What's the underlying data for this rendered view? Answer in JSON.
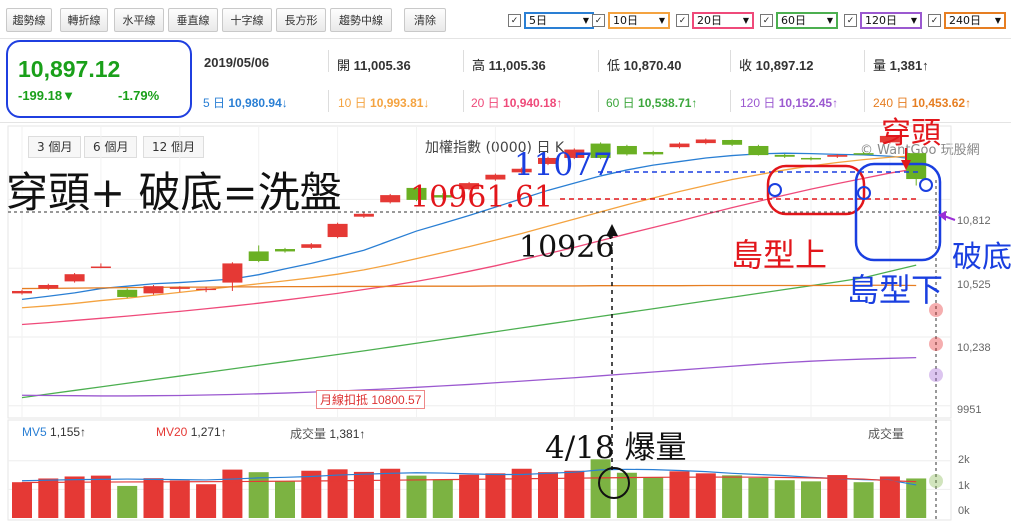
{
  "toolbar": {
    "buttons": [
      "趨勢線",
      "轉折線",
      "水平線",
      "垂直線",
      "十字線",
      "長方形",
      "趨勢中線",
      "清除"
    ],
    "ma_selectors": [
      {
        "label": "5日",
        "color": "#2a7fd4",
        "checked": true
      },
      {
        "label": "10日",
        "color": "#f4a340",
        "checked": true
      },
      {
        "label": "20日",
        "color": "#ef4a7a",
        "checked": true
      },
      {
        "label": "60日",
        "color": "#4caf50",
        "checked": true
      },
      {
        "label": "120日",
        "color": "#9b59d0",
        "checked": true
      },
      {
        "label": "240日",
        "color": "#e67e22",
        "checked": true
      }
    ]
  },
  "quote": {
    "price": "10,897.12",
    "change": "-199.18▼",
    "change_pct": "-1.79%",
    "date": "2019/05/06",
    "open_label": "開",
    "open": "11,005.36",
    "high_label": "高",
    "high": "11,005.36",
    "low_label": "低",
    "low": "10,870.40",
    "close_label": "收",
    "close": "10,897.12",
    "vol_label": "量",
    "vol": "1,381↑",
    "ma": [
      {
        "label": "5 日",
        "value": "10,980.94↓",
        "color": "#2a7fd4"
      },
      {
        "label": "10 日",
        "value": "10,993.81↓",
        "color": "#f4a340"
      },
      {
        "label": "20 日",
        "value": "10,940.18↑",
        "color": "#ef4a7a"
      },
      {
        "label": "60 日",
        "value": "10,538.71↑",
        "color": "#3ca63c"
      },
      {
        "label": "120 日",
        "value": "10,152.45↑",
        "color": "#9b59d0"
      },
      {
        "label": "240 日",
        "value": "10,453.62↑",
        "color": "#e67e22"
      }
    ]
  },
  "tabs": [
    "3 個月",
    "6 個月",
    "12 個月"
  ],
  "chart_title": "加權指數 (0000) 日 K",
  "watermark": "© WantGoo 玩股網",
  "annotations": {
    "main": "穿頭+ 破底=洗盤",
    "peak": "11077",
    "level1": "10961.61",
    "level2": "10926",
    "island_up": "島型上",
    "island_down": "島型下",
    "breakout_top": "穿頭",
    "breakdown": "破底",
    "volume_burst": "4/18 爆量",
    "month_line": "月線扣抵 10800.57"
  },
  "volume_header": {
    "mv5_label": "MV5",
    "mv5": "1,155↑",
    "mv20_label": "MV20",
    "mv20": "1,271↑",
    "vol_label": "成交量",
    "vol": "1,381↑",
    "right_label": "成交量"
  },
  "chart_data": {
    "type": "candlestick",
    "y_ticks": [
      "10,812",
      "10,525",
      "10,238",
      "9951"
    ],
    "vol_ticks": [
      "2k",
      "1k",
      "0k"
    ],
    "ylim": [
      9900,
      11110
    ],
    "vol_ylim": [
      0,
      2200
    ],
    "candles": [
      {
        "o": 10420,
        "c": 10430,
        "h": 10435,
        "l": 10415,
        "v": 1250,
        "up": true
      },
      {
        "o": 10440,
        "c": 10455,
        "h": 10460,
        "l": 10435,
        "v": 1380,
        "up": true
      },
      {
        "o": 10470,
        "c": 10500,
        "h": 10505,
        "l": 10465,
        "v": 1450,
        "up": true
      },
      {
        "o": 10530,
        "c": 10532,
        "h": 10545,
        "l": 10525,
        "v": 1480,
        "up": true
      },
      {
        "o": 10435,
        "c": 10405,
        "h": 10440,
        "l": 10400,
        "v": 1120,
        "up": false
      },
      {
        "o": 10420,
        "c": 10450,
        "h": 10455,
        "l": 10415,
        "v": 1390,
        "up": true
      },
      {
        "o": 10445,
        "c": 10445,
        "h": 10450,
        "l": 10425,
        "v": 1310,
        "up": true
      },
      {
        "o": 10435,
        "c": 10440,
        "h": 10448,
        "l": 10425,
        "v": 1180,
        "up": true
      },
      {
        "o": 10465,
        "c": 10545,
        "h": 10550,
        "l": 10430,
        "v": 1690,
        "up": true
      },
      {
        "o": 10595,
        "c": 10555,
        "h": 10620,
        "l": 10550,
        "v": 1600,
        "up": false
      },
      {
        "o": 10605,
        "c": 10595,
        "h": 10610,
        "l": 10590,
        "v": 1280,
        "up": false
      },
      {
        "o": 10610,
        "c": 10625,
        "h": 10630,
        "l": 10605,
        "v": 1650,
        "up": true
      },
      {
        "o": 10655,
        "c": 10710,
        "h": 10715,
        "l": 10650,
        "v": 1700,
        "up": true
      },
      {
        "o": 10740,
        "c": 10752,
        "h": 10760,
        "l": 10735,
        "v": 1610,
        "up": true
      },
      {
        "o": 10800,
        "c": 10830,
        "h": 10835,
        "l": 10795,
        "v": 1720,
        "up": true
      },
      {
        "o": 10860,
        "c": 10810,
        "h": 10862,
        "l": 10805,
        "v": 1480,
        "up": false
      },
      {
        "o": 10830,
        "c": 10820,
        "h": 10838,
        "l": 10812,
        "v": 1350,
        "up": false
      },
      {
        "o": 10855,
        "c": 10880,
        "h": 10885,
        "l": 10850,
        "v": 1510,
        "up": true
      },
      {
        "o": 10895,
        "c": 10915,
        "h": 10920,
        "l": 10890,
        "v": 1560,
        "up": true
      },
      {
        "o": 10925,
        "c": 10940,
        "h": 10945,
        "l": 10920,
        "v": 1720,
        "up": true
      },
      {
        "o": 10960,
        "c": 10985,
        "h": 10990,
        "l": 10955,
        "v": 1600,
        "up": true
      },
      {
        "o": 10985,
        "c": 11020,
        "h": 11025,
        "l": 10980,
        "v": 1650,
        "up": true
      },
      {
        "o": 11045,
        "c": 10985,
        "h": 11050,
        "l": 10980,
        "v": 2050,
        "up": false
      },
      {
        "o": 11035,
        "c": 11000,
        "h": 11040,
        "l": 10995,
        "v": 1580,
        "up": false
      },
      {
        "o": 11010,
        "c": 11000,
        "h": 11015,
        "l": 10995,
        "v": 1420,
        "up": false
      },
      {
        "o": 11030,
        "c": 11045,
        "h": 11050,
        "l": 11025,
        "v": 1630,
        "up": true
      },
      {
        "o": 11047,
        "c": 11062,
        "h": 11066,
        "l": 11042,
        "v": 1560,
        "up": true
      },
      {
        "o": 11060,
        "c": 11040,
        "h": 11062,
        "l": 11035,
        "v": 1490,
        "up": false
      },
      {
        "o": 11035,
        "c": 10997,
        "h": 11040,
        "l": 10995,
        "v": 1400,
        "up": false
      },
      {
        "o": 10998,
        "c": 10990,
        "h": 11002,
        "l": 10985,
        "v": 1320,
        "up": false
      },
      {
        "o": 10985,
        "c": 10980,
        "h": 10990,
        "l": 10975,
        "v": 1280,
        "up": false
      },
      {
        "o": 10990,
        "c": 10997,
        "h": 11000,
        "l": 10985,
        "v": 1500,
        "up": true
      },
      {
        "o": 11005,
        "c": 11003,
        "h": 11010,
        "l": 11000,
        "v": 1250,
        "up": false
      },
      {
        "o": 11050,
        "c": 11077,
        "h": 11077,
        "l": 11045,
        "v": 1450,
        "up": true
      },
      {
        "o": 11005,
        "c": 10897,
        "h": 11005,
        "l": 10870,
        "v": 1381,
        "up": false
      }
    ],
    "ma_lines": [
      {
        "name": "5日",
        "color": "#2a7fd4",
        "values": [
          10395,
          10408,
          10422,
          10440,
          10450,
          10460,
          10465,
          10472,
          10480,
          10498,
          10522,
          10545,
          10572,
          10600,
          10640,
          10680,
          10712,
          10745,
          10780,
          10815,
          10850,
          10880,
          10910,
          10935,
          10955,
          10970,
          10985,
          10995,
          11002,
          11005,
          11003,
          11000,
          10998,
          10992,
          10980
        ]
      },
      {
        "name": "10日",
        "color": "#f4a340",
        "values": [
          10360,
          10368,
          10378,
          10390,
          10400,
          10412,
          10424,
          10436,
          10448,
          10460,
          10472,
          10485,
          10500,
          10518,
          10540,
          10565,
          10590,
          10615,
          10642,
          10670,
          10700,
          10730,
          10760,
          10790,
          10818,
          10845,
          10870,
          10895,
          10915,
          10935,
          10952,
          10966,
          10978,
          10988,
          10994
        ]
      },
      {
        "name": "20日",
        "color": "#ef4a7a",
        "values": [
          10290,
          10298,
          10307,
          10316,
          10325,
          10335,
          10345,
          10356,
          10367,
          10379,
          10392,
          10406,
          10420,
          10436,
          10452,
          10470,
          10490,
          10512,
          10535,
          10560,
          10586,
          10612,
          10640,
          10668,
          10695,
          10722,
          10750,
          10778,
          10804,
          10830,
          10855,
          10878,
          10900,
          10922,
          10940
        ]
      },
      {
        "name": "60日",
        "color": "#4caf50",
        "values": [
          9985,
          10000,
          10015,
          10030,
          10045,
          10060,
          10075,
          10090,
          10105,
          10120,
          10135,
          10150,
          10165,
          10180,
          10196,
          10212,
          10228,
          10244,
          10260,
          10276,
          10292,
          10308,
          10324,
          10340,
          10356,
          10372,
          10388,
          10404,
          10420,
          10436,
          10452,
          10468,
          10485,
          10512,
          10538
        ]
      },
      {
        "name": "120日",
        "color": "#9b59d0",
        "values": [
          9995,
          9994,
          9993,
          9992,
          9992,
          9993,
          9994,
          9996,
          9998,
          10001,
          10004,
          10008,
          10012,
          10017,
          10022,
          10028,
          10034,
          10040,
          10047,
          10054,
          10061,
          10068,
          10076,
          10084,
          10092,
          10100,
          10108,
          10116,
          10124,
          10131,
          10137,
          10142,
          10146,
          10149,
          10152
        ]
      },
      {
        "name": "240日",
        "color": "#e67e22",
        "values": [
          10440,
          10441,
          10442,
          10443,
          10444,
          10445,
          10446,
          10446,
          10447,
          10447,
          10448,
          10448,
          10449,
          10449,
          10449,
          10450,
          10450,
          10450,
          10451,
          10451,
          10451,
          10451,
          10452,
          10452,
          10452,
          10452,
          10453,
          10453,
          10453,
          10453,
          10453,
          10453,
          10454,
          10454,
          10453
        ]
      }
    ],
    "mv5": [
      1300,
      1320,
      1340,
      1350,
      1360,
      1350,
      1340,
      1330,
      1360,
      1400,
      1420,
      1450,
      1500,
      1530,
      1560,
      1580,
      1570,
      1540,
      1520,
      1520,
      1560,
      1600,
      1680,
      1700,
      1690,
      1660,
      1620,
      1560,
      1520,
      1480,
      1420,
      1380,
      1340,
      1320,
      1155
    ],
    "mv20": [
      1240,
      1245,
      1250,
      1255,
      1260,
      1262,
      1265,
      1268,
      1272,
      1278,
      1285,
      1292,
      1300,
      1310,
      1320,
      1330,
      1340,
      1350,
      1360,
      1370,
      1380,
      1390,
      1400,
      1410,
      1420,
      1425,
      1428,
      1430,
      1425,
      1415,
      1400,
      1385,
      1360,
      1300,
      1271
    ]
  }
}
